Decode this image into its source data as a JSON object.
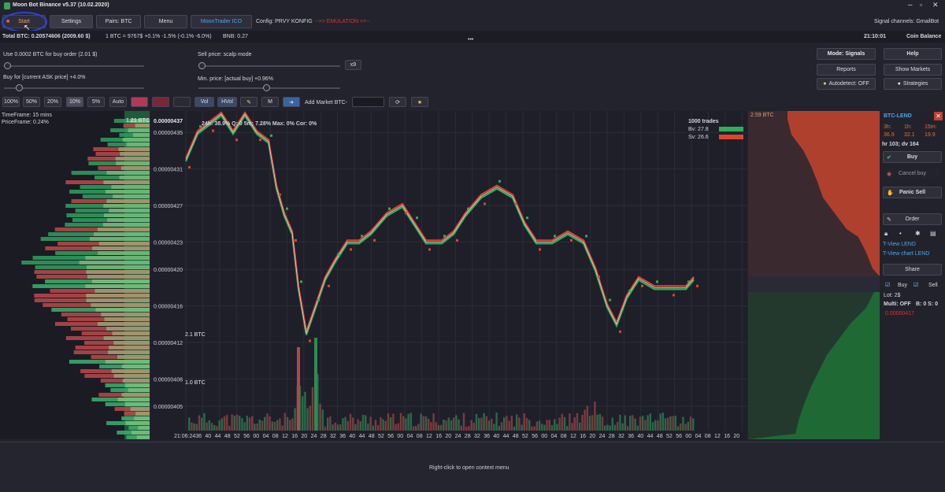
{
  "titlebar": {
    "title": "Moon Bot Binance v5.37 (10.02.2020)"
  },
  "toolbar": {
    "start": "Start",
    "settings": "Settings",
    "pairs": "Pairs: BTC",
    "menu": "Menu",
    "moontrader": "MoonTrader ICO",
    "config": "Config: PRVY KONFIG",
    "emulation": "-->> EMULATION <<--",
    "signal": "Signal channels: GmailBot"
  },
  "status": {
    "total": "Total BTC: 0.20574606 (2009.60 $)",
    "rate": "1 BTC = 9767$  +0.1%  -1.5%  (-0.1%  -6.0%)",
    "bnb": "BNB: 0.27",
    "time": "21:10:01",
    "coin_balance": "Coin Balance"
  },
  "controls": {
    "buy_order": "Use 0.0002 BTC for buy order  (2.01 $)",
    "buy_for": "Buy for [current ASK price] +4.0%",
    "sell_price": "Sell price: scalp mode",
    "min_price": "Min. price: [actual buy] +0.96%",
    "x9": "x9",
    "buy_level": 0.12,
    "sell_level": 0.48
  },
  "right_buttons": {
    "mode": "Mode: Signals",
    "help": "Help",
    "reports": "Reports",
    "show_markets": "Show Markets",
    "autodetect": "Autodetect: OFF",
    "strategies": "Strategies"
  },
  "quick": {
    "p100": "100%",
    "p50": "50%",
    "p20": "20%",
    "p10": "10%",
    "p5": "5%",
    "auto": "Auto",
    "vol": "Vol",
    "hvol": "HVol",
    "m": "M",
    "add_market": "Add Market BTC-"
  },
  "left_panel": {
    "timeframe": "TimeFrame: 15 mins",
    "priceframe": "PriceFrame: 0.24%",
    "btc": "1.21 BTC"
  },
  "chart": {
    "stats": "24h: 38.9%  Q: 0  5m: 7.28%  Max: 0%  Cor: 0%",
    "price_top": "0.00000437",
    "trades": "1000 trades",
    "bv": "Bv: 27.8",
    "sv": "Sv: 26.6",
    "vol1": "2.1 BTC",
    "vol2": "1.0 BTC",
    "right_btc": "2.59 BTC",
    "yticks": [
      "0.00000435",
      "0.00000431",
      "0.00000427",
      "0.00000423",
      "0.00000420",
      "0.00000416",
      "0.00000412",
      "0.00000408",
      "0.00000405"
    ],
    "xticks": [
      "21:06:24",
      "36",
      "40",
      "44",
      "48",
      "52",
      "56",
      "00",
      "04",
      "08",
      "12",
      "16",
      "20",
      "24",
      "28",
      "32",
      "36",
      "40",
      "44",
      "48",
      "52",
      "56",
      "00",
      "04",
      "08",
      "12",
      "16",
      "20",
      "24",
      "28",
      "32",
      "36",
      "40",
      "44",
      "48",
      "52",
      "56",
      "00",
      "04",
      "08",
      "12",
      "16",
      "20",
      "24",
      "28",
      "32",
      "36",
      "40",
      "44",
      "48",
      "52",
      "56",
      "00",
      "04",
      "08",
      "12",
      "16",
      "20"
    ]
  },
  "side": {
    "pair": "BTC-LEND",
    "h3": "3h:",
    "h1": "1h:",
    "m15": "15m:",
    "v3": "36.9",
    "v1": "32.1",
    "v15": "19.9",
    "hr": "hr 103; dv 164",
    "buy": "Buy",
    "cancel": "Cancel buy",
    "panic": "Panic Sell",
    "order": "Order",
    "tview": "T-View LEND",
    "tview_chart": "T-View chart LEND",
    "share": "Share",
    "buy2": "Buy",
    "sell2": "Sell",
    "lot": "Lot: 2$",
    "multi": "Multi: OFF",
    "bs": "B: 0  S: 0",
    "price": "0.00000417"
  },
  "footer": {
    "hint": "Right-click to open context menu"
  }
}
